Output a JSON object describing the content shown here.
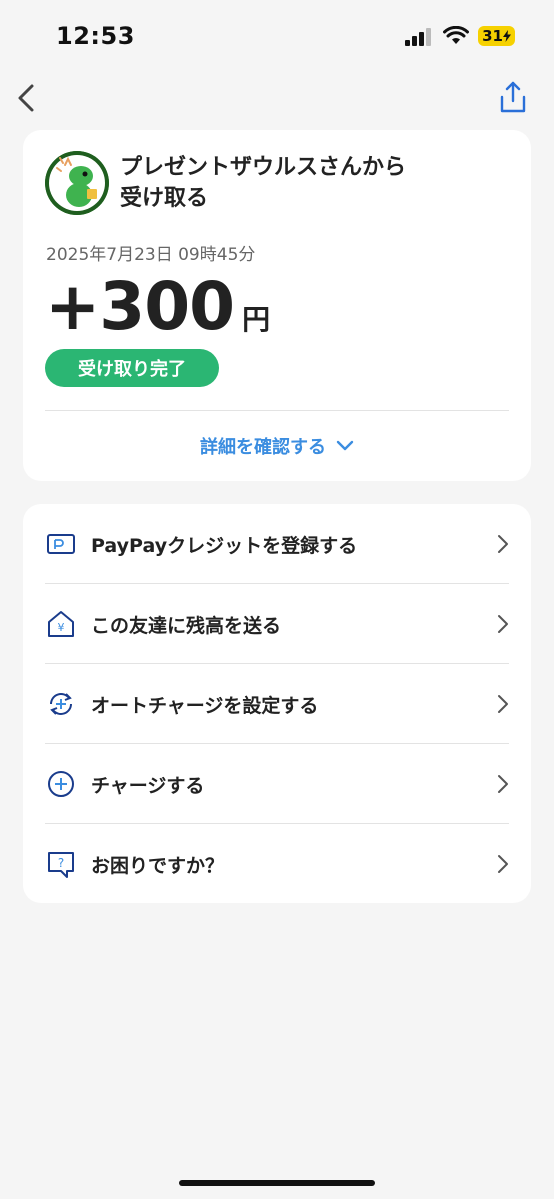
{
  "status_bar": {
    "time": "12:53",
    "battery": "31"
  },
  "nav": {
    "back_icon": "chevron-left-icon",
    "share_icon": "share-icon"
  },
  "receipt": {
    "sender_title_line1": "プレゼントザウルスさんから",
    "sender_title_line2": "受け取る",
    "datetime": "2025年7月23日 09時45分",
    "amount": "+300",
    "unit": "円",
    "status": "受け取り完了",
    "details_link": "詳細を確認する"
  },
  "menu": {
    "items": [
      {
        "label": "PayPayクレジットを登録する",
        "icon": "credit-card-icon"
      },
      {
        "label": "この友達に残高を送る",
        "icon": "send-yen-icon"
      },
      {
        "label": "オートチャージを設定する",
        "icon": "auto-charge-icon"
      },
      {
        "label": "チャージする",
        "icon": "plus-circle-icon"
      },
      {
        "label": "お困りですか？",
        "icon": "help-bubble-icon"
      }
    ]
  },
  "colors": {
    "accent": "#3b8de0",
    "success": "#2bb673",
    "icon_blue": "#1a3c8c",
    "battery": "#f6d100"
  }
}
